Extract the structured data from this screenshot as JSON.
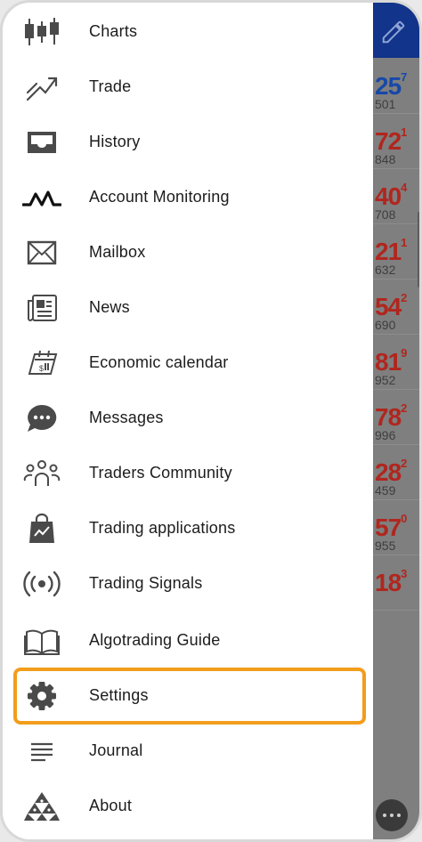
{
  "menu": {
    "items": [
      {
        "label": "Charts",
        "icon": "candlestick-chart-icon"
      },
      {
        "label": "Trade",
        "icon": "trade-trend-icon"
      },
      {
        "label": "History",
        "icon": "inbox-tray-icon"
      },
      {
        "label": "Account Monitoring",
        "icon": "monitoring-wave-icon"
      },
      {
        "label": "Mailbox",
        "icon": "envelope-icon"
      },
      {
        "label": "News",
        "icon": "newspaper-icon"
      },
      {
        "label": "Economic calendar",
        "icon": "calendar-icon"
      },
      {
        "label": "Messages",
        "icon": "chat-bubble-icon"
      },
      {
        "label": "Traders Community",
        "icon": "community-people-icon"
      },
      {
        "label": "Trading applications",
        "icon": "shopping-bag-icon"
      },
      {
        "label": "Trading Signals",
        "icon": "broadcast-signal-icon"
      },
      {
        "label": "Algotrading Guide",
        "icon": "open-book-icon"
      },
      {
        "label": "Settings",
        "icon": "gear-icon"
      },
      {
        "label": "Journal",
        "icon": "journal-lines-icon"
      },
      {
        "label": "About",
        "icon": "about-logo-icon"
      }
    ],
    "highlighted": "Settings"
  },
  "background_quotes": [
    {
      "big": "25",
      "sup": "7",
      "small": "501",
      "color": "#1848a8"
    },
    {
      "big": "72",
      "sup": "1",
      "small": "848",
      "color": "#b0261e"
    },
    {
      "big": "40",
      "sup": "4",
      "small": "708",
      "color": "#b0261e"
    },
    {
      "big": "21",
      "sup": "1",
      "small": "632",
      "color": "#b0261e"
    },
    {
      "big": "54",
      "sup": "2",
      "small": "690",
      "color": "#b0261e"
    },
    {
      "big": "81",
      "sup": "9",
      "small": "952",
      "color": "#b0261e"
    },
    {
      "big": "78",
      "sup": "2",
      "small": "996",
      "color": "#b0261e"
    },
    {
      "big": "28",
      "sup": "2",
      "small": "459",
      "color": "#b0261e"
    },
    {
      "big": "57",
      "sup": "0",
      "small": "955",
      "color": "#b0261e"
    },
    {
      "big": "18",
      "sup": "3",
      "small": "",
      "color": "#b0261e"
    }
  ],
  "colors": {
    "highlight": "#f29d1c",
    "topbar": "#12348a",
    "icon": "#4a4a4a"
  }
}
